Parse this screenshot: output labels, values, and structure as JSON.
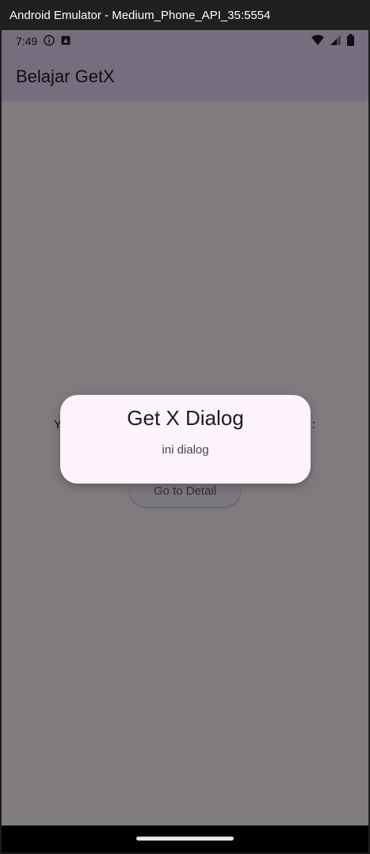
{
  "window": {
    "title": "Android Emulator - Medium_Phone_API_35:5554"
  },
  "status_bar": {
    "time": "7:49",
    "icons_left": [
      "info-icon",
      "app-notification-icon"
    ],
    "icons_right": [
      "wifi-icon",
      "signal-icon",
      "battery-icon"
    ]
  },
  "app_bar": {
    "title": "Belajar GetX"
  },
  "main": {
    "text_left": "Y",
    "text_right": ":",
    "detail_button": "Go to Detail"
  },
  "fabs": [
    {
      "name": "add",
      "icon": "plus-icon"
    },
    {
      "name": "remove",
      "icon": "minus-icon"
    },
    {
      "name": "dialog",
      "icon": "message-icon"
    },
    {
      "name": "notification",
      "icon": "bell-icon"
    },
    {
      "name": "navigate-up",
      "icon": "arrow-up-icon"
    }
  ],
  "dialog": {
    "title": "Get X Dialog",
    "content": "ini dialog"
  },
  "colors": {
    "app_bar": "#e9ddff",
    "fab": "#eaddff",
    "dialog": "#fcf3fb",
    "scrim": "rgba(0,0,0,0.5)"
  }
}
